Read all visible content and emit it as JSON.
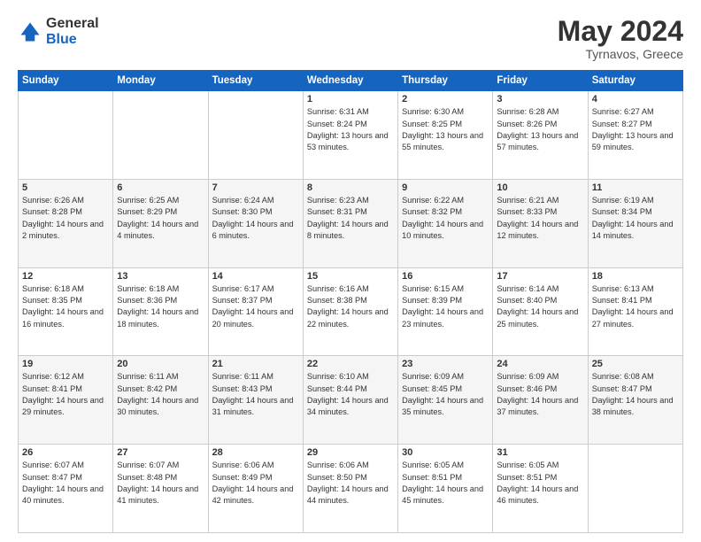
{
  "logo": {
    "general": "General",
    "blue": "Blue"
  },
  "header": {
    "month": "May 2024",
    "location": "Tyrnavos, Greece"
  },
  "weekdays": [
    "Sunday",
    "Monday",
    "Tuesday",
    "Wednesday",
    "Thursday",
    "Friday",
    "Saturday"
  ],
  "weeks": [
    [
      {
        "day": "",
        "sunrise": "",
        "sunset": "",
        "daylight": ""
      },
      {
        "day": "",
        "sunrise": "",
        "sunset": "",
        "daylight": ""
      },
      {
        "day": "",
        "sunrise": "",
        "sunset": "",
        "daylight": ""
      },
      {
        "day": "1",
        "sunrise": "Sunrise: 6:31 AM",
        "sunset": "Sunset: 8:24 PM",
        "daylight": "Daylight: 13 hours and 53 minutes."
      },
      {
        "day": "2",
        "sunrise": "Sunrise: 6:30 AM",
        "sunset": "Sunset: 8:25 PM",
        "daylight": "Daylight: 13 hours and 55 minutes."
      },
      {
        "day": "3",
        "sunrise": "Sunrise: 6:28 AM",
        "sunset": "Sunset: 8:26 PM",
        "daylight": "Daylight: 13 hours and 57 minutes."
      },
      {
        "day": "4",
        "sunrise": "Sunrise: 6:27 AM",
        "sunset": "Sunset: 8:27 PM",
        "daylight": "Daylight: 13 hours and 59 minutes."
      }
    ],
    [
      {
        "day": "5",
        "sunrise": "Sunrise: 6:26 AM",
        "sunset": "Sunset: 8:28 PM",
        "daylight": "Daylight: 14 hours and 2 minutes."
      },
      {
        "day": "6",
        "sunrise": "Sunrise: 6:25 AM",
        "sunset": "Sunset: 8:29 PM",
        "daylight": "Daylight: 14 hours and 4 minutes."
      },
      {
        "day": "7",
        "sunrise": "Sunrise: 6:24 AM",
        "sunset": "Sunset: 8:30 PM",
        "daylight": "Daylight: 14 hours and 6 minutes."
      },
      {
        "day": "8",
        "sunrise": "Sunrise: 6:23 AM",
        "sunset": "Sunset: 8:31 PM",
        "daylight": "Daylight: 14 hours and 8 minutes."
      },
      {
        "day": "9",
        "sunrise": "Sunrise: 6:22 AM",
        "sunset": "Sunset: 8:32 PM",
        "daylight": "Daylight: 14 hours and 10 minutes."
      },
      {
        "day": "10",
        "sunrise": "Sunrise: 6:21 AM",
        "sunset": "Sunset: 8:33 PM",
        "daylight": "Daylight: 14 hours and 12 minutes."
      },
      {
        "day": "11",
        "sunrise": "Sunrise: 6:19 AM",
        "sunset": "Sunset: 8:34 PM",
        "daylight": "Daylight: 14 hours and 14 minutes."
      }
    ],
    [
      {
        "day": "12",
        "sunrise": "Sunrise: 6:18 AM",
        "sunset": "Sunset: 8:35 PM",
        "daylight": "Daylight: 14 hours and 16 minutes."
      },
      {
        "day": "13",
        "sunrise": "Sunrise: 6:18 AM",
        "sunset": "Sunset: 8:36 PM",
        "daylight": "Daylight: 14 hours and 18 minutes."
      },
      {
        "day": "14",
        "sunrise": "Sunrise: 6:17 AM",
        "sunset": "Sunset: 8:37 PM",
        "daylight": "Daylight: 14 hours and 20 minutes."
      },
      {
        "day": "15",
        "sunrise": "Sunrise: 6:16 AM",
        "sunset": "Sunset: 8:38 PM",
        "daylight": "Daylight: 14 hours and 22 minutes."
      },
      {
        "day": "16",
        "sunrise": "Sunrise: 6:15 AM",
        "sunset": "Sunset: 8:39 PM",
        "daylight": "Daylight: 14 hours and 23 minutes."
      },
      {
        "day": "17",
        "sunrise": "Sunrise: 6:14 AM",
        "sunset": "Sunset: 8:40 PM",
        "daylight": "Daylight: 14 hours and 25 minutes."
      },
      {
        "day": "18",
        "sunrise": "Sunrise: 6:13 AM",
        "sunset": "Sunset: 8:41 PM",
        "daylight": "Daylight: 14 hours and 27 minutes."
      }
    ],
    [
      {
        "day": "19",
        "sunrise": "Sunrise: 6:12 AM",
        "sunset": "Sunset: 8:41 PM",
        "daylight": "Daylight: 14 hours and 29 minutes."
      },
      {
        "day": "20",
        "sunrise": "Sunrise: 6:11 AM",
        "sunset": "Sunset: 8:42 PM",
        "daylight": "Daylight: 14 hours and 30 minutes."
      },
      {
        "day": "21",
        "sunrise": "Sunrise: 6:11 AM",
        "sunset": "Sunset: 8:43 PM",
        "daylight": "Daylight: 14 hours and 31 minutes."
      },
      {
        "day": "22",
        "sunrise": "Sunrise: 6:10 AM",
        "sunset": "Sunset: 8:44 PM",
        "daylight": "Daylight: 14 hours and 34 minutes."
      },
      {
        "day": "23",
        "sunrise": "Sunrise: 6:09 AM",
        "sunset": "Sunset: 8:45 PM",
        "daylight": "Daylight: 14 hours and 35 minutes."
      },
      {
        "day": "24",
        "sunrise": "Sunrise: 6:09 AM",
        "sunset": "Sunset: 8:46 PM",
        "daylight": "Daylight: 14 hours and 37 minutes."
      },
      {
        "day": "25",
        "sunrise": "Sunrise: 6:08 AM",
        "sunset": "Sunset: 8:47 PM",
        "daylight": "Daylight: 14 hours and 38 minutes."
      }
    ],
    [
      {
        "day": "26",
        "sunrise": "Sunrise: 6:07 AM",
        "sunset": "Sunset: 8:47 PM",
        "daylight": "Daylight: 14 hours and 40 minutes."
      },
      {
        "day": "27",
        "sunrise": "Sunrise: 6:07 AM",
        "sunset": "Sunset: 8:48 PM",
        "daylight": "Daylight: 14 hours and 41 minutes."
      },
      {
        "day": "28",
        "sunrise": "Sunrise: 6:06 AM",
        "sunset": "Sunset: 8:49 PM",
        "daylight": "Daylight: 14 hours and 42 minutes."
      },
      {
        "day": "29",
        "sunrise": "Sunrise: 6:06 AM",
        "sunset": "Sunset: 8:50 PM",
        "daylight": "Daylight: 14 hours and 44 minutes."
      },
      {
        "day": "30",
        "sunrise": "Sunrise: 6:05 AM",
        "sunset": "Sunset: 8:51 PM",
        "daylight": "Daylight: 14 hours and 45 minutes."
      },
      {
        "day": "31",
        "sunrise": "Sunrise: 6:05 AM",
        "sunset": "Sunset: 8:51 PM",
        "daylight": "Daylight: 14 hours and 46 minutes."
      },
      {
        "day": "",
        "sunrise": "",
        "sunset": "",
        "daylight": ""
      }
    ]
  ]
}
